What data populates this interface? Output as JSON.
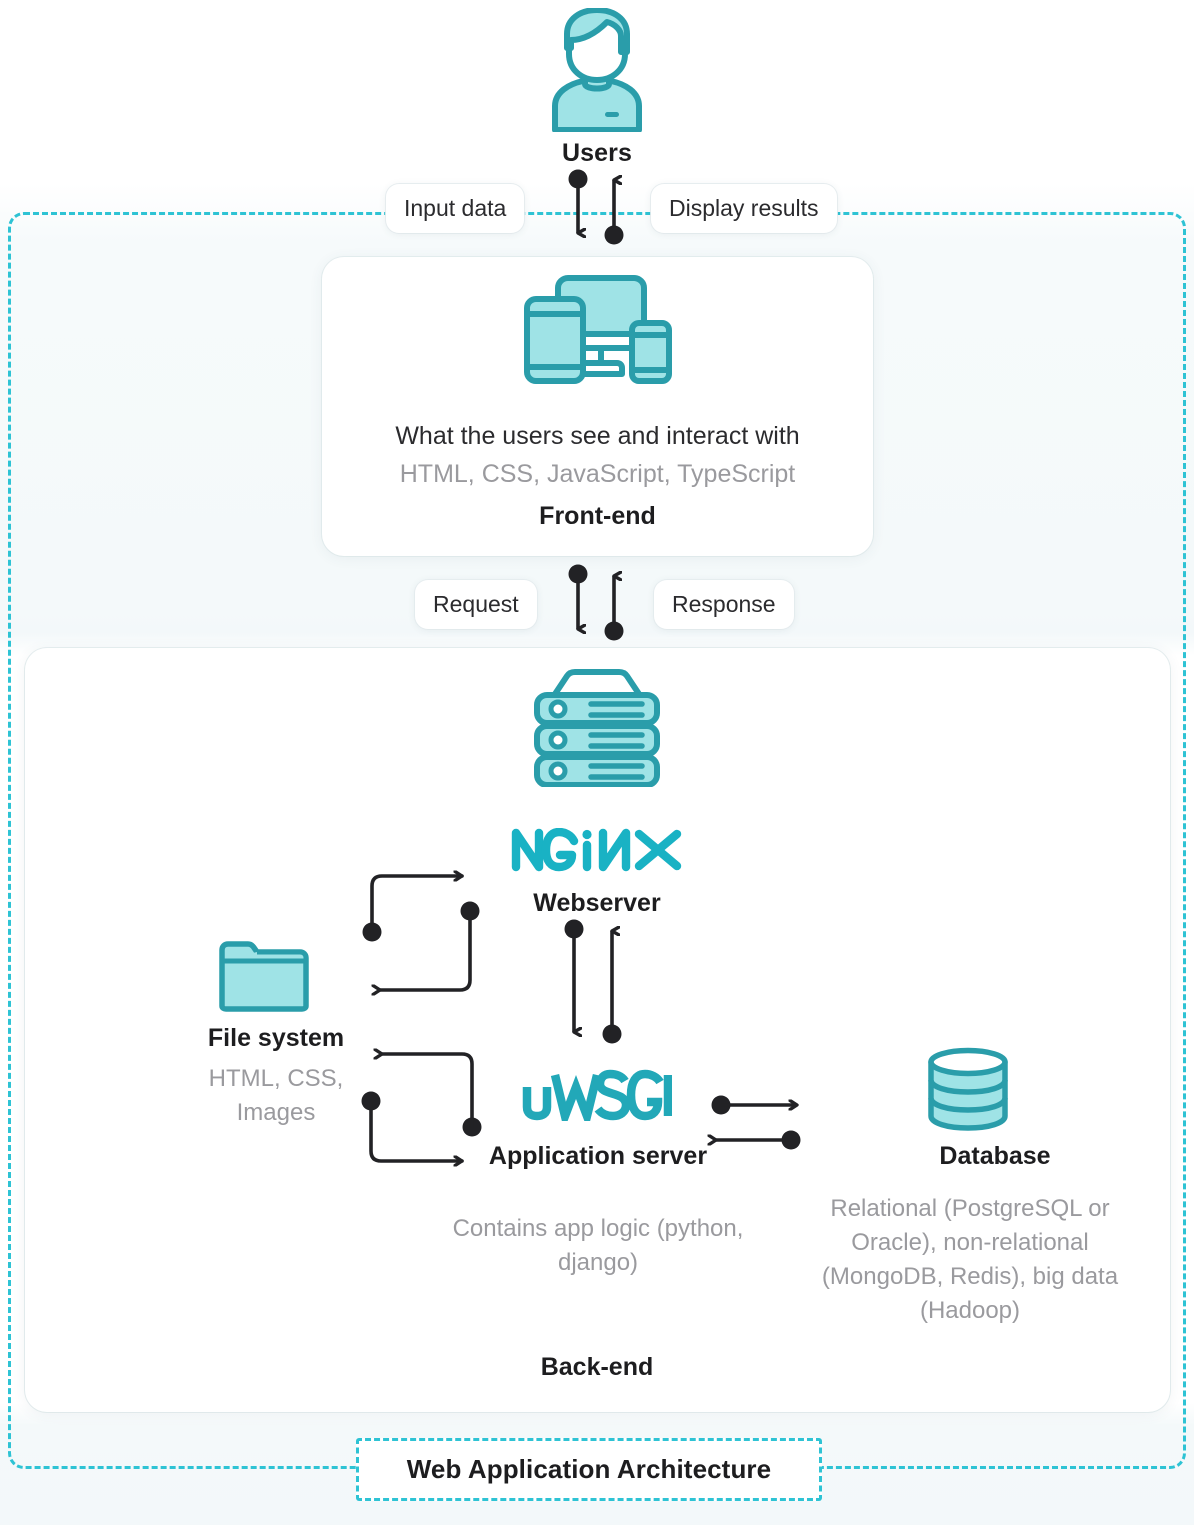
{
  "diagram": {
    "title": "Web Application Architecture",
    "colors": {
      "accent_dashed": "#2ec3d4",
      "icon_stroke": "#2a9daa",
      "icon_fill": "#9fe3e6",
      "nginx_green": "#19b2c4",
      "uwsgi_teal": "#22a8b8",
      "text_dark": "#1d1d1f",
      "text_muted": "#9a9a9e",
      "arrow_black": "#222225"
    }
  },
  "users": {
    "icon": "user-avatar-icon",
    "label": "Users"
  },
  "flows": {
    "input_data": "Input data",
    "display_results": "Display results",
    "request": "Request",
    "response": "Response"
  },
  "frontend": {
    "icon": "multi-device-icon",
    "description": "What the users see and interact with",
    "technologies": "HTML, CSS, JavaScript, TypeScript",
    "title": "Front-end"
  },
  "backend": {
    "title": "Back-end",
    "server_icon": "server-rack-icon",
    "webserver": {
      "logo_text": "NGINX",
      "label": "Webserver"
    },
    "application_server": {
      "logo_text": "uWSGI",
      "label": "Application server",
      "description": "Contains app logic (python, django)"
    },
    "file_system": {
      "icon": "folder-icon",
      "label": "File system",
      "description": "HTML, CSS, Images"
    },
    "database": {
      "icon": "database-cylinder-icon",
      "label": "Database",
      "description": "Relational (PostgreSQL or Oracle), non-relational (MongoDB, Redis), big data (Hadoop)"
    }
  }
}
